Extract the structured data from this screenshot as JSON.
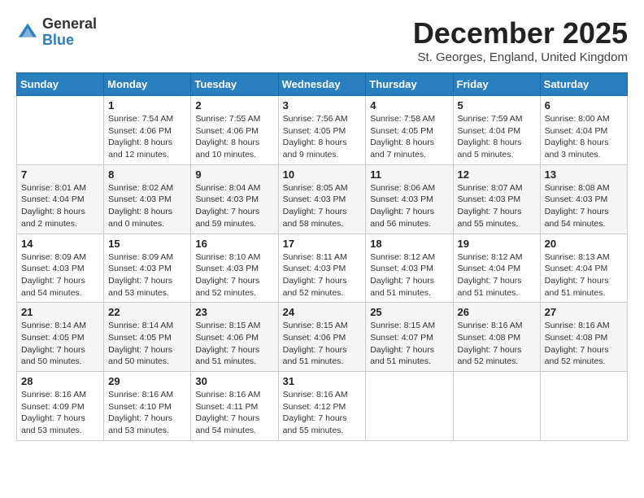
{
  "logo": {
    "general": "General",
    "blue": "Blue"
  },
  "title": "December 2025",
  "subtitle": "St. Georges, England, United Kingdom",
  "days_of_week": [
    "Sunday",
    "Monday",
    "Tuesday",
    "Wednesday",
    "Thursday",
    "Friday",
    "Saturday"
  ],
  "weeks": [
    [
      {
        "day": "",
        "info": ""
      },
      {
        "day": "1",
        "info": "Sunrise: 7:54 AM\nSunset: 4:06 PM\nDaylight: 8 hours\nand 12 minutes."
      },
      {
        "day": "2",
        "info": "Sunrise: 7:55 AM\nSunset: 4:06 PM\nDaylight: 8 hours\nand 10 minutes."
      },
      {
        "day": "3",
        "info": "Sunrise: 7:56 AM\nSunset: 4:05 PM\nDaylight: 8 hours\nand 9 minutes."
      },
      {
        "day": "4",
        "info": "Sunrise: 7:58 AM\nSunset: 4:05 PM\nDaylight: 8 hours\nand 7 minutes."
      },
      {
        "day": "5",
        "info": "Sunrise: 7:59 AM\nSunset: 4:04 PM\nDaylight: 8 hours\nand 5 minutes."
      },
      {
        "day": "6",
        "info": "Sunrise: 8:00 AM\nSunset: 4:04 PM\nDaylight: 8 hours\nand 3 minutes."
      }
    ],
    [
      {
        "day": "7",
        "info": "Sunrise: 8:01 AM\nSunset: 4:04 PM\nDaylight: 8 hours\nand 2 minutes."
      },
      {
        "day": "8",
        "info": "Sunrise: 8:02 AM\nSunset: 4:03 PM\nDaylight: 8 hours\nand 0 minutes."
      },
      {
        "day": "9",
        "info": "Sunrise: 8:04 AM\nSunset: 4:03 PM\nDaylight: 7 hours\nand 59 minutes."
      },
      {
        "day": "10",
        "info": "Sunrise: 8:05 AM\nSunset: 4:03 PM\nDaylight: 7 hours\nand 58 minutes."
      },
      {
        "day": "11",
        "info": "Sunrise: 8:06 AM\nSunset: 4:03 PM\nDaylight: 7 hours\nand 56 minutes."
      },
      {
        "day": "12",
        "info": "Sunrise: 8:07 AM\nSunset: 4:03 PM\nDaylight: 7 hours\nand 55 minutes."
      },
      {
        "day": "13",
        "info": "Sunrise: 8:08 AM\nSunset: 4:03 PM\nDaylight: 7 hours\nand 54 minutes."
      }
    ],
    [
      {
        "day": "14",
        "info": "Sunrise: 8:09 AM\nSunset: 4:03 PM\nDaylight: 7 hours\nand 54 minutes."
      },
      {
        "day": "15",
        "info": "Sunrise: 8:09 AM\nSunset: 4:03 PM\nDaylight: 7 hours\nand 53 minutes."
      },
      {
        "day": "16",
        "info": "Sunrise: 8:10 AM\nSunset: 4:03 PM\nDaylight: 7 hours\nand 52 minutes."
      },
      {
        "day": "17",
        "info": "Sunrise: 8:11 AM\nSunset: 4:03 PM\nDaylight: 7 hours\nand 52 minutes."
      },
      {
        "day": "18",
        "info": "Sunrise: 8:12 AM\nSunset: 4:03 PM\nDaylight: 7 hours\nand 51 minutes."
      },
      {
        "day": "19",
        "info": "Sunrise: 8:12 AM\nSunset: 4:04 PM\nDaylight: 7 hours\nand 51 minutes."
      },
      {
        "day": "20",
        "info": "Sunrise: 8:13 AM\nSunset: 4:04 PM\nDaylight: 7 hours\nand 51 minutes."
      }
    ],
    [
      {
        "day": "21",
        "info": "Sunrise: 8:14 AM\nSunset: 4:05 PM\nDaylight: 7 hours\nand 50 minutes."
      },
      {
        "day": "22",
        "info": "Sunrise: 8:14 AM\nSunset: 4:05 PM\nDaylight: 7 hours\nand 50 minutes."
      },
      {
        "day": "23",
        "info": "Sunrise: 8:15 AM\nSunset: 4:06 PM\nDaylight: 7 hours\nand 51 minutes."
      },
      {
        "day": "24",
        "info": "Sunrise: 8:15 AM\nSunset: 4:06 PM\nDaylight: 7 hours\nand 51 minutes."
      },
      {
        "day": "25",
        "info": "Sunrise: 8:15 AM\nSunset: 4:07 PM\nDaylight: 7 hours\nand 51 minutes."
      },
      {
        "day": "26",
        "info": "Sunrise: 8:16 AM\nSunset: 4:08 PM\nDaylight: 7 hours\nand 52 minutes."
      },
      {
        "day": "27",
        "info": "Sunrise: 8:16 AM\nSunset: 4:08 PM\nDaylight: 7 hours\nand 52 minutes."
      }
    ],
    [
      {
        "day": "28",
        "info": "Sunrise: 8:16 AM\nSunset: 4:09 PM\nDaylight: 7 hours\nand 53 minutes."
      },
      {
        "day": "29",
        "info": "Sunrise: 8:16 AM\nSunset: 4:10 PM\nDaylight: 7 hours\nand 53 minutes."
      },
      {
        "day": "30",
        "info": "Sunrise: 8:16 AM\nSunset: 4:11 PM\nDaylight: 7 hours\nand 54 minutes."
      },
      {
        "day": "31",
        "info": "Sunrise: 8:16 AM\nSunset: 4:12 PM\nDaylight: 7 hours\nand 55 minutes."
      },
      {
        "day": "",
        "info": ""
      },
      {
        "day": "",
        "info": ""
      },
      {
        "day": "",
        "info": ""
      }
    ]
  ]
}
